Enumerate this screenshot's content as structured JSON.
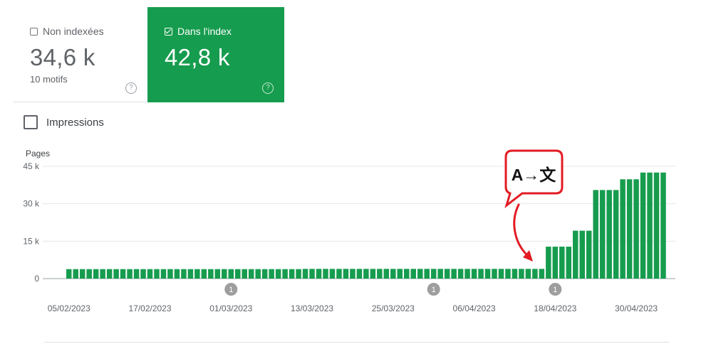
{
  "cards": {
    "non_indexed": {
      "label": "Non indexées",
      "value": "34,6 k",
      "sub": "10 motifs",
      "checked": false,
      "help": "?"
    },
    "indexed": {
      "label": "Dans l'index",
      "value": "42,8 k",
      "checked": true,
      "help": "?",
      "color": "#169c4e"
    }
  },
  "impressions": {
    "label": "Impressions",
    "checked": false
  },
  "annotation": {
    "badge_text": "A→文",
    "badge_color": "#e31b23",
    "arrow_color": "#e31b23"
  },
  "chart_data": {
    "type": "bar",
    "ylabel": "Pages",
    "ylim": [
      0,
      45000
    ],
    "y_ticks": [
      {
        "value": 0,
        "label": "0"
      },
      {
        "value": 15000,
        "label": "15 k"
      },
      {
        "value": 30000,
        "label": "30 k"
      },
      {
        "value": 45000,
        "label": "45 k"
      }
    ],
    "x_start": "2023-02-05",
    "x_tick_labels": [
      "05/02/2023",
      "17/02/2023",
      "01/03/2023",
      "13/03/2023",
      "25/03/2023",
      "06/04/2023",
      "18/04/2023",
      "30/04/2023"
    ],
    "bar_color": "#169c4e",
    "grid": true,
    "markers": [
      {
        "date": "2023-03-01",
        "label": "1"
      },
      {
        "date": "2023-03-31",
        "label": "1"
      },
      {
        "date": "2023-04-18",
        "label": "1"
      }
    ],
    "series": [
      {
        "values": [
          3800,
          3800,
          3800,
          3800,
          3800,
          3800,
          3800,
          3800,
          3800,
          3800,
          3800,
          3800,
          3800,
          3800,
          3800,
          3800,
          3800,
          3800,
          3800,
          3800,
          3800,
          3800,
          3800,
          3800,
          3800,
          3800,
          3800,
          3800,
          3800,
          3800,
          3800,
          3800,
          3800,
          3800,
          3800,
          3900,
          3900,
          3900,
          3900,
          3900,
          3900,
          3900,
          3900,
          3900,
          3900,
          3900,
          3900,
          3900,
          3900,
          3900,
          3900,
          3900,
          3900,
          3900,
          3900,
          3900,
          3900,
          3900,
          3900,
          3900,
          3900,
          3900,
          3900,
          3900,
          3900,
          3900,
          3900,
          3900,
          3900,
          3900,
          3900,
          12800,
          12800,
          12800,
          12800,
          19200,
          19200,
          19200,
          35500,
          35500,
          35500,
          35500,
          39800,
          39800,
          39800,
          42500,
          42500,
          42500,
          42500
        ]
      }
    ]
  }
}
